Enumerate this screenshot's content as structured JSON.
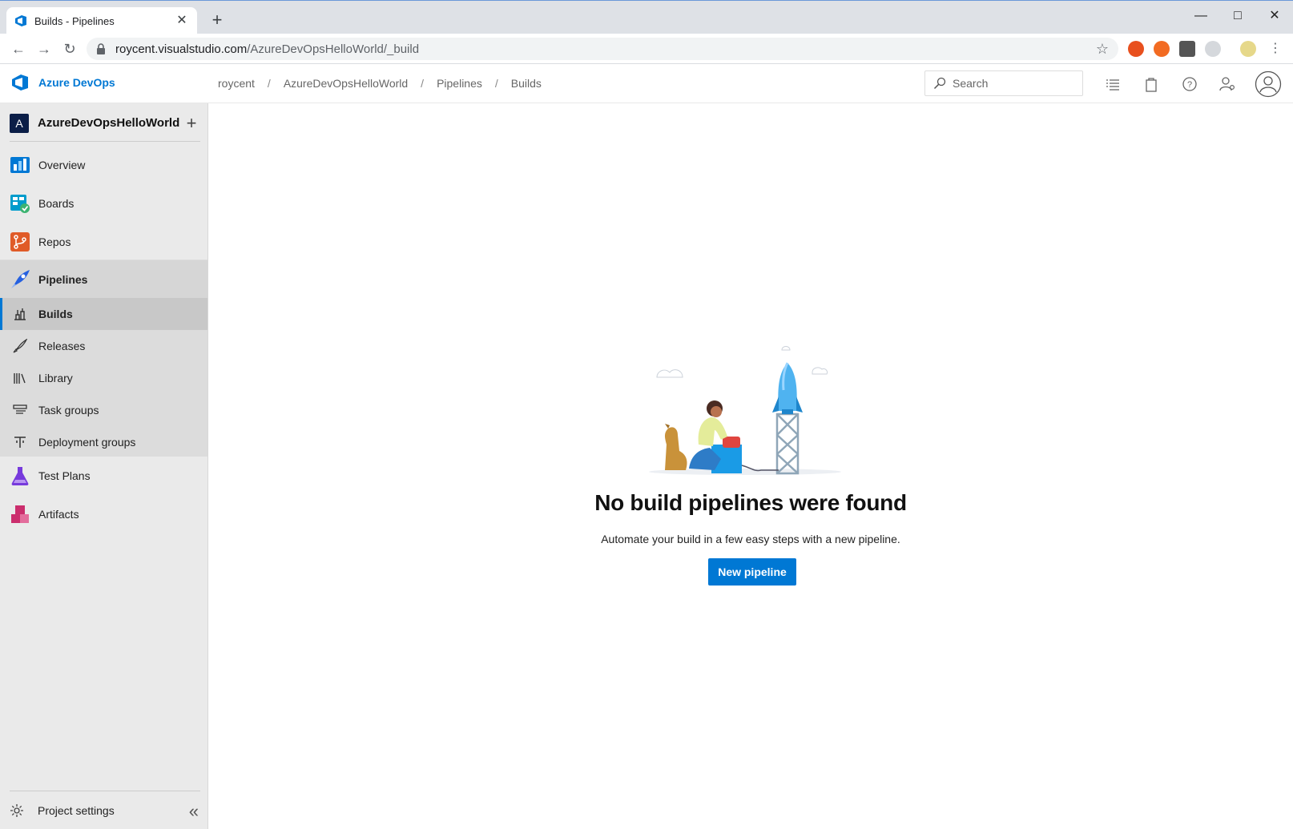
{
  "browser": {
    "tab_title": "Builds - Pipelines",
    "tab_close": "✕",
    "new_tab": "+",
    "url_host": "roycent.visualstudio.com",
    "url_path": "/AzureDevOpsHelloWorld/_build"
  },
  "header": {
    "brand": "Azure DevOps",
    "breadcrumb": [
      "roycent",
      "AzureDevOpsHelloWorld",
      "Pipelines",
      "Builds"
    ],
    "breadcrumb_sep": "/",
    "search_placeholder": "Search"
  },
  "sidebar": {
    "project_initial": "A",
    "project_name": "AzureDevOpsHelloWorld",
    "items": [
      {
        "label": "Overview",
        "color": "#0078d4"
      },
      {
        "label": "Boards",
        "color": "#009ccc"
      },
      {
        "label": "Repos",
        "color": "#e05b28"
      },
      {
        "label": "Pipelines",
        "color": "#2560e0"
      },
      {
        "label": "Test Plans",
        "color": "#773adc"
      },
      {
        "label": "Artifacts",
        "color": "#cb2e6d"
      }
    ],
    "sub_items": [
      {
        "label": "Builds",
        "active": true
      },
      {
        "label": "Releases"
      },
      {
        "label": "Library"
      },
      {
        "label": "Task groups"
      },
      {
        "label": "Deployment groups"
      }
    ],
    "settings_label": "Project settings"
  },
  "main": {
    "empty_title": "No build pipelines were found",
    "empty_desc": "Automate your build in a few easy steps with a new pipeline.",
    "new_pipeline_label": "New pipeline"
  },
  "colors": {
    "accent": "#0078d4",
    "sidebar_bg": "#eaeaea",
    "pipelines_section_bg": "#dcdcdc"
  }
}
